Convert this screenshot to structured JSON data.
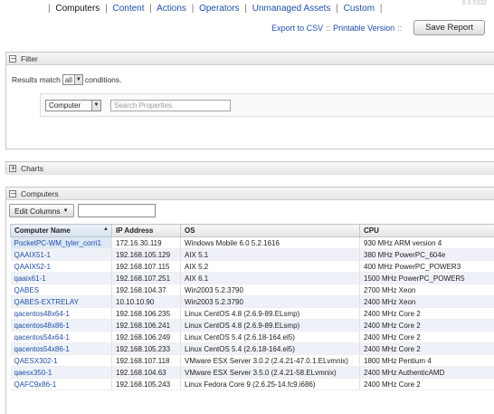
{
  "version": "8.0.5332",
  "nav": {
    "items": [
      "Computers",
      "Content",
      "Actions",
      "Operators",
      "Unmanaged Assets",
      "Custom"
    ],
    "trailing_sep": "|"
  },
  "actions": {
    "export_csv": "Export to CSV",
    "separator": "::",
    "printable": "Printable Version",
    "save_report": "Save Report"
  },
  "filter": {
    "title": "Filter",
    "results_prefix": "Results match",
    "match_value": "all",
    "results_suffix": "conditions.",
    "property_select": "Computer",
    "search_placeholder": "Search Properties"
  },
  "charts": {
    "title": "Charts"
  },
  "computers": {
    "title": "Computers",
    "edit_columns": "Edit Columns",
    "columns": [
      "Computer Name",
      "IP Address",
      "OS",
      "CPU"
    ],
    "rows": [
      [
        "PocketPC-WM_tyler_corri1",
        "172.16.30.119",
        "Windows Mobile 6.0 5.2.1616",
        "930 MHz ARM version 4"
      ],
      [
        "QAAIX51-1",
        "192.168.105.129",
        "AIX 5.1",
        "380 MHz PowerPC_604e"
      ],
      [
        "QAAIX52-1",
        "192.168.107.115",
        "AIX 5.2",
        "400 MHz PowerPC_POWER3"
      ],
      [
        "qaaix61-1",
        "192.168.107.251",
        "AIX 6.1",
        "1500 MHz PowerPC_POWER5"
      ],
      [
        "QABES",
        "192.168.104.37",
        "Win2003 5.2.3790",
        "2700 MHz Xeon"
      ],
      [
        "QABES-EXTRELAY",
        "10.10.10.90",
        "Win2003 5.2.3790",
        "2400 MHz Xeon"
      ],
      [
        "qacentos48x64-1",
        "192.168.106.235",
        "Linux CentOS 4.8 (2.6.9-89.ELsmp)",
        "2400 MHz Core 2"
      ],
      [
        "qacentos48x86-1",
        "192.168.106.241",
        "Linux CentOS 4.8 (2.6.9-89.ELsmp)",
        "2400 MHz Core 2"
      ],
      [
        "qacentos54x64-1",
        "192.168.106.249",
        "Linux CentOS 5.4 (2.6.18-164.el5)",
        "2400 MHz Core 2"
      ],
      [
        "qacentos54x86-1",
        "192.168.105.233",
        "Linux CentOS 5.4 (2.6.18-164.el5)",
        "2400 MHz Core 2"
      ],
      [
        "QAESX302-1",
        "192.168.107.118",
        "VMware ESX Server 3.0.2 (2.4.21-47.0.1.ELvmnix)",
        "1800 MHz Pentium 4"
      ],
      [
        "qaesx350-1",
        "192.168.104.63",
        "VMware ESX Server 3.5.0 (2.4.21-58.ELvmnix)",
        "2400 MHz AuthenticAMD"
      ],
      [
        "QAFC9x86-1",
        "192.168.105.243",
        "Linux Fedora Core 9 (2.6.25-14.fc9.i686)",
        "2400 MHz Core 2"
      ]
    ]
  }
}
